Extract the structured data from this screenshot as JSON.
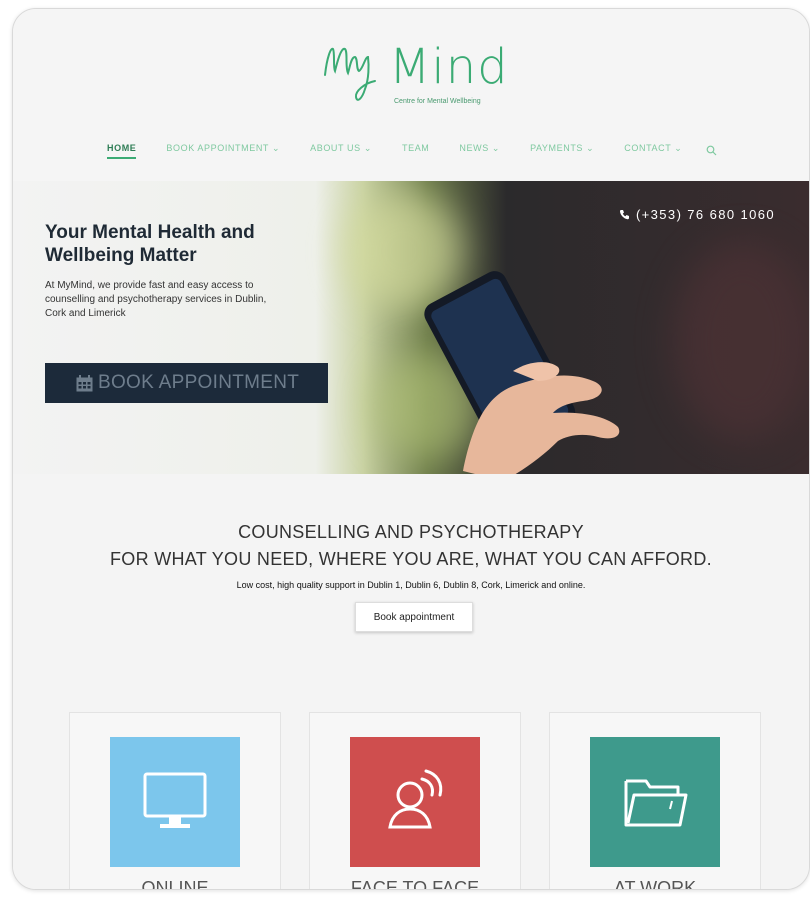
{
  "brand": {
    "name": "Mind",
    "tagline": "Centre for Mental Wellbeing",
    "color": "#3bab74"
  },
  "nav": {
    "items": [
      "HOME",
      "BOOK APPOINTMENT ⌄",
      "ABOUT US ⌄",
      "TEAM",
      "NEWS ⌄",
      "PAYMENTS ⌄",
      "CONTACT ⌄"
    ],
    "active": "HOME",
    "search_icon": "search-icon"
  },
  "hero": {
    "title": "Your Mental Health and Wellbeing Matter",
    "text": "At MyMind, we provide fast and easy access to counselling and psychotherapy services in Dublin, Cork and Limerick",
    "button_label": "BOOK APPOINTMENT",
    "button_icon": "calendar-icon",
    "phone": "(+353) 76 680 1060",
    "phone_icon": "phone-icon",
    "button_color": "#1c2a3a"
  },
  "section": {
    "heading_line1": "COUNSELLING AND PSYCHOTHERAPY",
    "heading_line2": "FOR WHAT YOU NEED, WHERE YOU ARE, WHAT YOU CAN AFFORD.",
    "subtext": "Low cost, high quality support in Dublin 1, Dublin 6, Dublin 8, Cork, Limerick and online.",
    "button_label": "Book appointment"
  },
  "cards": [
    {
      "label": "ONLINE",
      "icon": "monitor-icon",
      "color": "#7cc6ec"
    },
    {
      "label": "FACE TO FACE",
      "icon": "person-speech-icon",
      "color": "#cf4e4e"
    },
    {
      "label": "AT WORK",
      "icon": "folder-icon",
      "color": "#3e9a8c"
    }
  ]
}
